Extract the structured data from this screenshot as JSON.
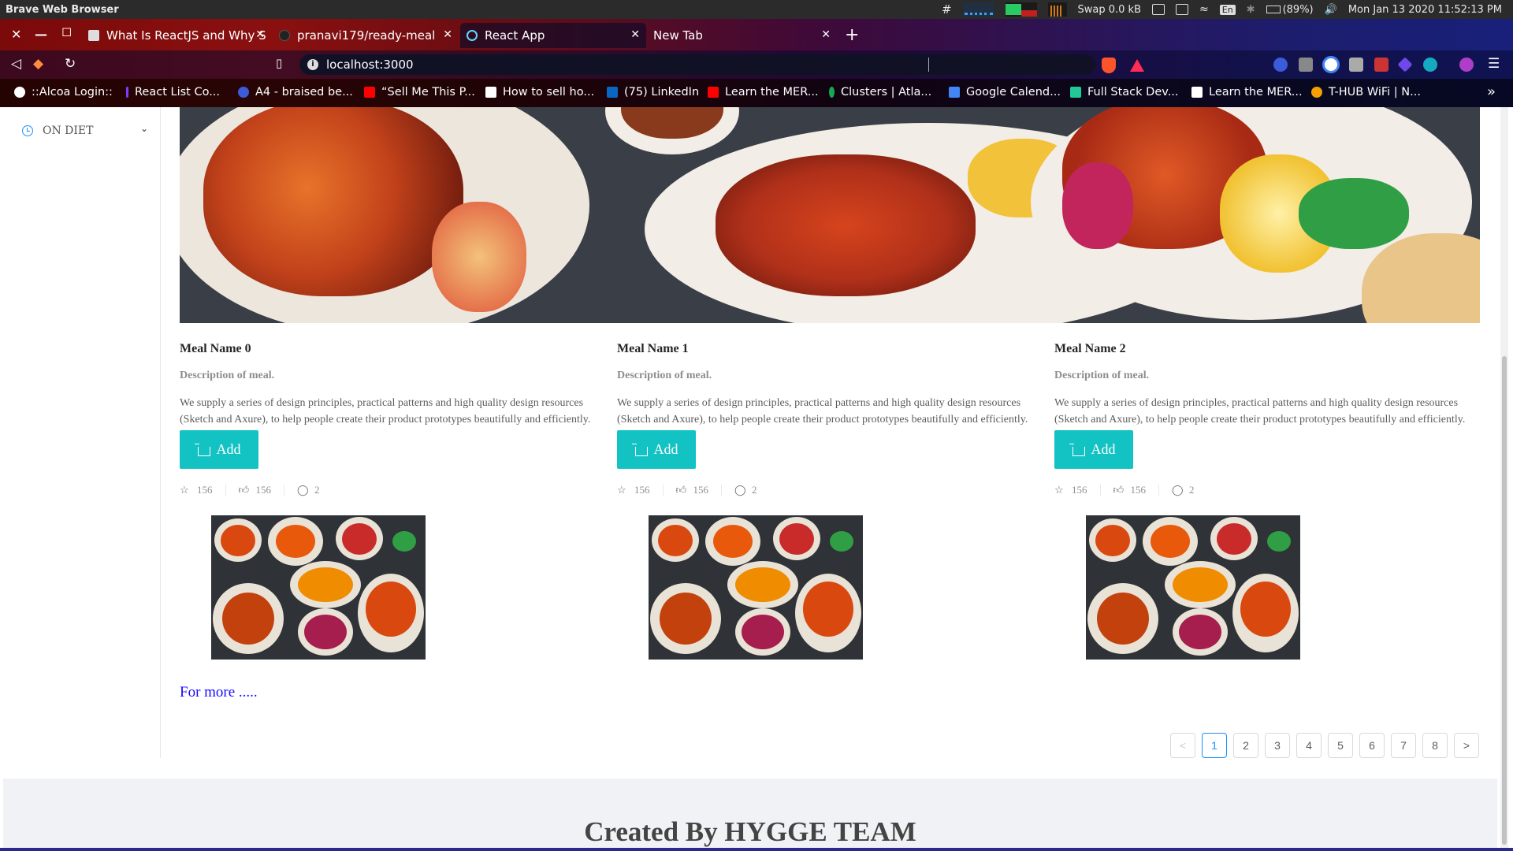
{
  "os_bar": {
    "app_name": "Brave Web Browser",
    "swap": "Swap 0.0 kB",
    "lang": "En",
    "battery": "(89%)",
    "datetime": "Mon Jan 13 2020 11:52:13 PM"
  },
  "tabs": [
    {
      "title": "What Is ReactJS and Why S",
      "favicon": "document-icon",
      "color": "#dddddd"
    },
    {
      "title": "pranavi179/ready-meal",
      "favicon": "github-icon",
      "color": "#222222"
    },
    {
      "title": "React App",
      "favicon": "react-icon",
      "color": "#61dafb"
    },
    {
      "title": "New Tab",
      "favicon": "",
      "color": ""
    }
  ],
  "address_bar": {
    "url": "localhost:3000"
  },
  "bookmarks": [
    {
      "label": "::Alcoa Login::",
      "color": "#ffffff"
    },
    {
      "label": "React List Co...",
      "color": "#7a3cff"
    },
    {
      "label": "A4 - braised be...",
      "color": "#3b5bdb"
    },
    {
      "label": "“Sell Me This P...",
      "color": "#ff0000"
    },
    {
      "label": "How to sell ho...",
      "color": "#ffffff"
    },
    {
      "label": "(75) LinkedIn",
      "color": "#0a66c2"
    },
    {
      "label": "Learn the MER...",
      "color": "#ff0000"
    },
    {
      "label": "Clusters | Atla...",
      "color": "#13aa52"
    },
    {
      "label": "Google Calend...",
      "color": "#4285f4"
    },
    {
      "label": "Full Stack Dev...",
      "color": "#20c997"
    },
    {
      "label": "Learn the MER...",
      "color": "#ffffff"
    },
    {
      "label": "T-HUB WiFi | N...",
      "color": "#f59f00"
    }
  ],
  "sidebar": {
    "menu_label": "ON DIET"
  },
  "meals": [
    {
      "name": "Meal Name 0",
      "description": "Description of meal.",
      "body": "We supply a series of design principles, practical patterns and high quality design resources (Sketch and Axure), to help people create their product prototypes beautifully and efficiently.",
      "add_label": "Add",
      "stars": "156",
      "likes": "156",
      "comments": "2"
    },
    {
      "name": "Meal Name 1",
      "description": "Description of meal.",
      "body": "We supply a series of design principles, practical patterns and high quality design resources (Sketch and Axure), to help people create their product prototypes beautifully and efficiently.",
      "add_label": "Add",
      "stars": "156",
      "likes": "156",
      "comments": "2"
    },
    {
      "name": "Meal Name 2",
      "description": "Description of meal.",
      "body": "We supply a series of design principles, practical patterns and high quality design resources (Sketch and Axure), to help people create their product prototypes beautifully and efficiently.",
      "add_label": "Add",
      "stars": "156",
      "likes": "156",
      "comments": "2"
    }
  ],
  "for_more": "For more .....",
  "pagination": {
    "prev": "<",
    "next": ">",
    "pages": [
      "1",
      "2",
      "3",
      "4",
      "5",
      "6",
      "7",
      "8"
    ],
    "current": "1"
  },
  "footer": {
    "credit": "Created By HYGGE TEAM"
  },
  "colors": {
    "accent": "#13c2c2",
    "link": "#1a0dff",
    "active_page": "#1890ff"
  }
}
